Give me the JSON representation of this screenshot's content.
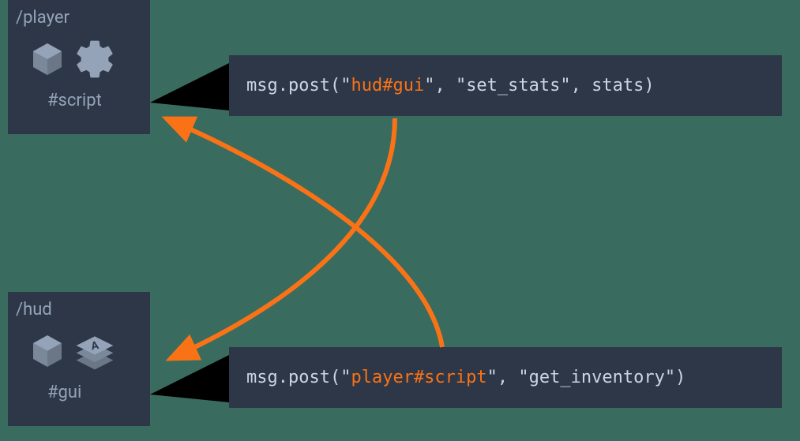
{
  "nodes": {
    "player": {
      "title": "/player",
      "component": "#script"
    },
    "hud": {
      "title": "/hud",
      "component": "#gui"
    }
  },
  "code": {
    "top": {
      "prefix": "msg.post(",
      "q1": "\"",
      "target": "hud#gui",
      "q2": "\"",
      "mid": ", ",
      "q3": "\"",
      "msgname": "set_stats",
      "q4": "\"",
      "suffix": ", stats)"
    },
    "bottom": {
      "prefix": "msg.post(",
      "q1": "\"",
      "target": "player#script",
      "q2": "\"",
      "mid": ", ",
      "q3": "\"",
      "msgname": "get_inventory",
      "q4": "\"",
      "suffix": ")"
    }
  },
  "colors": {
    "accent": "#f97316",
    "panel": "#2d3748",
    "bg": "#3a6b5f",
    "muted": "#94a3b8"
  }
}
